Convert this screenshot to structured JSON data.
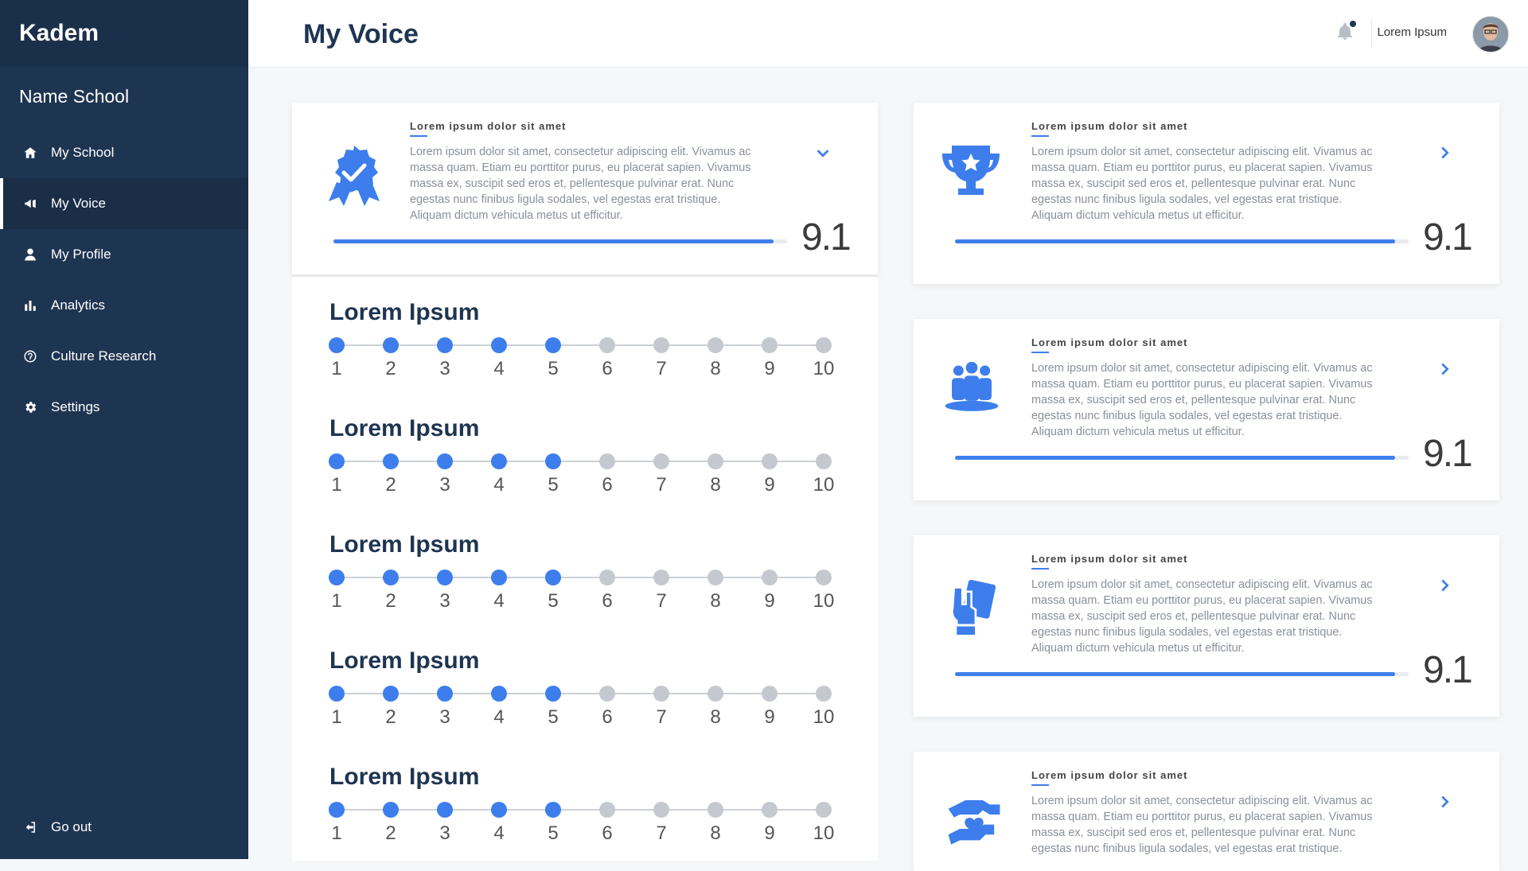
{
  "app": {
    "brand": "Kadem",
    "school": "Name School"
  },
  "nav": {
    "items": [
      {
        "label": "My School",
        "icon": "home-icon"
      },
      {
        "label": "My Voice",
        "icon": "megaphone-icon",
        "active": true
      },
      {
        "label": "My Profile",
        "icon": "user-icon"
      },
      {
        "label": "Analytics",
        "icon": "bar-chart-icon"
      },
      {
        "label": "Culture Research",
        "icon": "question-circle-icon"
      },
      {
        "label": "Settings",
        "icon": "gear-icon"
      }
    ],
    "logout": "Go out"
  },
  "header": {
    "title": "My Voice",
    "user_name": "Lorem Ipsum"
  },
  "cards": [
    {
      "heading": "Lorem ipsum dolor sit amet",
      "text": "Lorem ipsum dolor sit amet, consectetur adipiscing elit. Vivamus ac massa quam. Etiam eu porttitor purus, eu placerat sapien. Vivamus massa ex, suscipit sed eros et, pellentesque pulvinar erat. Nunc egestas nunc finibus ligula sodales, vel egestas erat tristique. Aliquam dictum vehicula metus ut efficitur.",
      "score": "9.1",
      "progress": 0.97,
      "icon": "award-ribbon-icon"
    },
    {
      "heading": "Lorem ipsum dolor sit amet",
      "text": "Lorem ipsum dolor sit amet, consectetur adipiscing elit. Vivamus ac massa quam. Etiam eu porttitor purus, eu placerat sapien. Vivamus massa ex, suscipit sed eros et, pellentesque pulvinar erat. Nunc egestas nunc finibus ligula sodales, vel egestas erat tristique. Aliquam dictum vehicula metus ut efficitur.",
      "score": "9.1",
      "progress": 0.97,
      "icon": "trophy-icon"
    },
    {
      "heading": "Lorem ipsum dolor sit amet",
      "text": "Lorem ipsum dolor sit amet, consectetur adipiscing elit. Vivamus ac massa quam. Etiam eu porttitor purus, eu placerat sapien. Vivamus massa ex, suscipit sed eros et, pellentesque pulvinar erat. Nunc egestas nunc finibus ligula sodales, vel egestas erat tristique. Aliquam dictum vehicula metus ut efficitur.",
      "score": "9.1",
      "progress": 0.97,
      "icon": "team-icon"
    },
    {
      "heading": "Lorem ipsum dolor sit amet",
      "text": "Lorem ipsum dolor sit amet, consectetur adipiscing elit. Vivamus ac massa quam. Etiam eu porttitor purus, eu placerat sapien. Vivamus massa ex, suscipit sed eros et, pellentesque pulvinar erat. Nunc egestas nunc finibus ligula sodales, vel egestas erat tristique. Aliquam dictum vehicula metus ut efficitur.",
      "score": "9.1",
      "progress": 0.97,
      "icon": "hand-card-icon"
    },
    {
      "heading": "Lorem ipsum dolor sit amet",
      "text": "Lorem ipsum dolor sit amet, consectetur adipiscing elit. Vivamus ac massa quam. Etiam eu porttitor purus, eu placerat sapien. Vivamus massa ex, suscipit sed eros et, pellentesque pulvinar erat. Nunc egestas nunc finibus ligula sodales, vel egestas erat tristique.",
      "icon": "care-hands-icon"
    }
  ],
  "questions": [
    {
      "title": "Lorem Ipsum",
      "value": 5
    },
    {
      "title": "Lorem Ipsum",
      "value": 5
    },
    {
      "title": "Lorem Ipsum",
      "value": 5
    },
    {
      "title": "Lorem Ipsum",
      "value": 5
    },
    {
      "title": "Lorem Ipsum",
      "value": 5
    }
  ],
  "scale": [
    "1",
    "2",
    "3",
    "4",
    "5",
    "6",
    "7",
    "8",
    "9",
    "10"
  ],
  "colors": {
    "sidebar": "#1e3552",
    "accent": "#3d7eec",
    "inactive_dot": "#c5c9cf"
  }
}
